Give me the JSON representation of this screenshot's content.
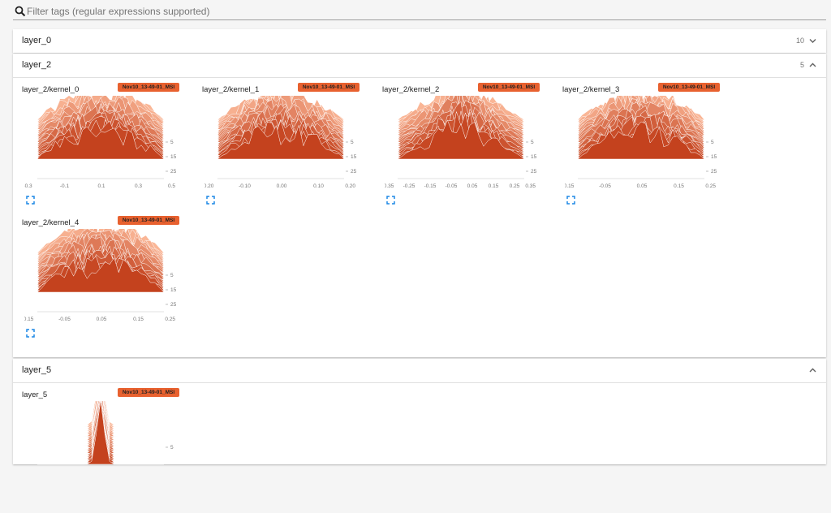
{
  "filter": {
    "placeholder": "Filter tags (regular expressions supported)"
  },
  "run_color": "#e8612f",
  "groups": [
    {
      "name": "layer_0",
      "count": "10",
      "expanded": false,
      "panels": []
    },
    {
      "name": "layer_2",
      "count": "5",
      "expanded": true,
      "panels": [
        {
          "title": "layer_2/kernel_0",
          "run": "Nov10_13-49-01_MSI",
          "x_ticks": [
            "-0.3",
            "-0.1",
            "0.1",
            "0.3",
            "0.5"
          ],
          "y_ticks": [
            "5",
            "15",
            "25"
          ]
        },
        {
          "title": "layer_2/kernel_1",
          "run": "Nov10_13-49-01_MSI",
          "x_ticks": [
            "-0.20",
            "-0.10",
            "0.00",
            "0.10",
            "0.20"
          ],
          "y_ticks": [
            "5",
            "15",
            "25"
          ]
        },
        {
          "title": "layer_2/kernel_2",
          "run": "Nov10_13-49-01_MSI",
          "x_ticks": [
            "-0.35",
            "-0.25",
            "-0.15",
            "-0.05",
            "0.05",
            "0.15",
            "0.25",
            "0.35"
          ],
          "y_ticks": [
            "5",
            "15",
            "25"
          ]
        },
        {
          "title": "layer_2/kernel_3",
          "run": "Nov10_13-49-01_MSI",
          "x_ticks": [
            "-0.15",
            "-0.05",
            "0.05",
            "0.15",
            "0.25"
          ],
          "y_ticks": [
            "5",
            "15",
            "25"
          ]
        },
        {
          "title": "layer_2/kernel_4",
          "run": "Nov10_13-49-01_MSI",
          "x_ticks": [
            "-0.15",
            "-0.05",
            "0.05",
            "0.15",
            "0.25"
          ],
          "y_ticks": [
            "5",
            "15",
            "25"
          ]
        }
      ]
    },
    {
      "name": "layer_5",
      "count": "",
      "expanded": true,
      "panels": [
        {
          "title": "layer_5",
          "run": "Nov10_13-49-01_MSI",
          "x_ticks": [],
          "y_ticks": [
            "5"
          ]
        }
      ]
    }
  ],
  "icons": {
    "search": "search-icon",
    "chevron_down": "chevron-down-icon",
    "chevron_up": "chevron-up-icon",
    "expand": "fullscreen-icon"
  }
}
